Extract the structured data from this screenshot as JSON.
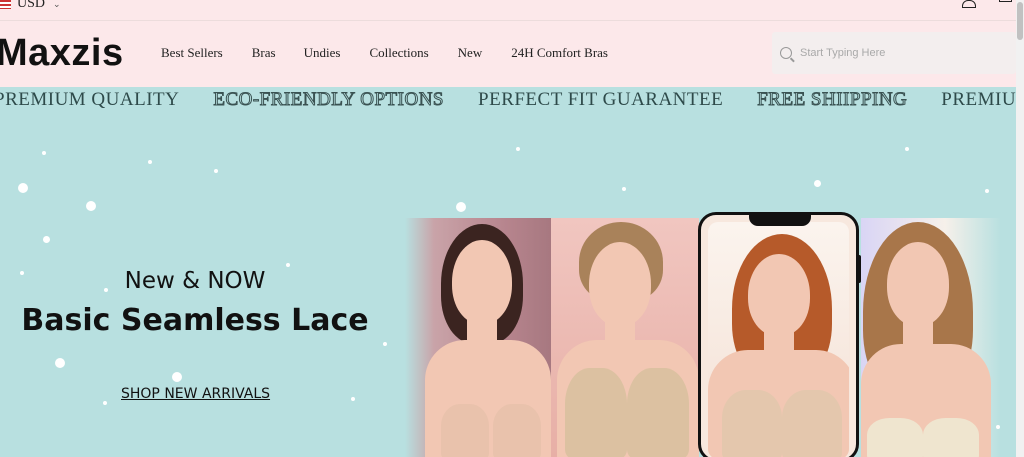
{
  "topbar": {
    "currency": "USD",
    "icons": [
      "flag-icon",
      "chevron-down-icon",
      "user-icon",
      "cart-icon"
    ]
  },
  "header": {
    "logo": "Maxzis",
    "nav": [
      "Best Sellers",
      "Bras",
      "Undies",
      "Collections",
      "New",
      "24H Comfort Bras"
    ],
    "search_placeholder": "Start Typing Here"
  },
  "marquee": [
    {
      "text": "PREMIUM QUALITY",
      "style": "solid"
    },
    {
      "text": "ECO-FRIENDLY OPTIONS",
      "style": "outline"
    },
    {
      "text": "PERFECT FIT GUARANTEE",
      "style": "solid"
    },
    {
      "text": "FREE SHIIPPING",
      "style": "outline"
    },
    {
      "text": "PREMIUM",
      "style": "solid"
    }
  ],
  "hero": {
    "subtitle": "New & NOW",
    "title": "Basic Seamless Lace",
    "cta": "SHOP NEW ARRIVALS"
  },
  "colors": {
    "header_bg": "#fce8ea",
    "hero_bg": "#b8e0e0",
    "text": "#111111"
  }
}
